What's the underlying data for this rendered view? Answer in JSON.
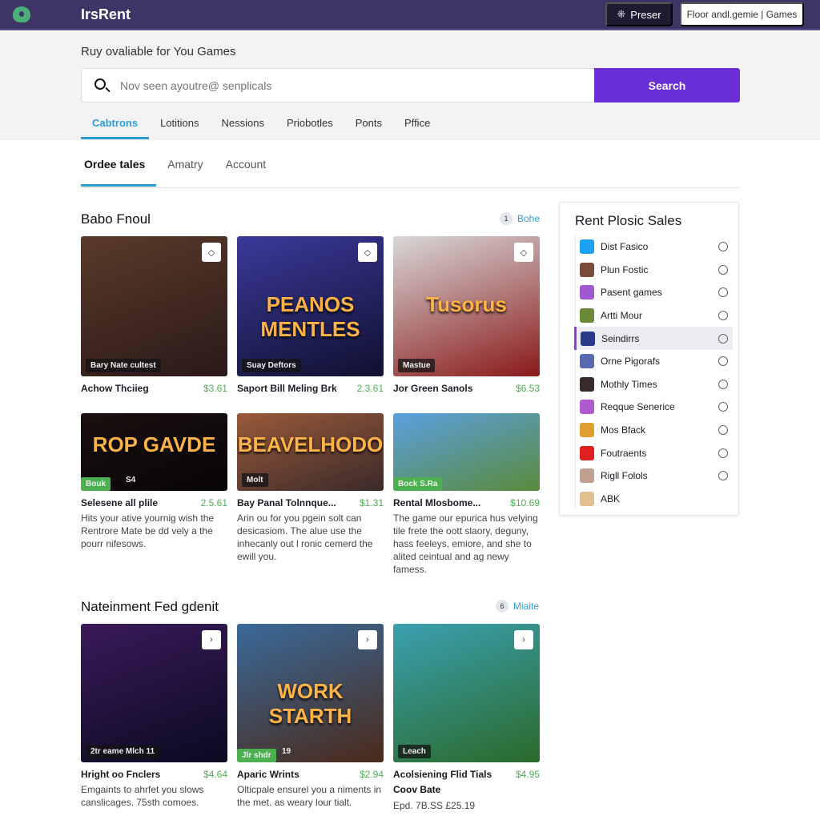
{
  "topbar": {
    "brand": "IrsRent",
    "preset_label": "Preser",
    "games_label": "Floor andl.gemie | Games"
  },
  "hero": {
    "title": "Ruy ovaliable for You Games",
    "search_placeholder": "Nov seen ayoutre@ senplicals",
    "search_button": "Search"
  },
  "tabs": [
    "Cabtrons",
    "Lotitions",
    "Nessions",
    "Priobotles",
    "Ponts",
    "Pffice"
  ],
  "subtabs": [
    "Ordee tales",
    "Amatry",
    "Account"
  ],
  "section1": {
    "title": "Babo Fnoul",
    "link_badge": "1",
    "link": "Bohe",
    "cards": [
      {
        "title": "Achow Thciieg",
        "price": "$3.61",
        "badge": "Bary Nate cultest",
        "art": "",
        "colors": [
          "#5a3a2a",
          "#2a1a18"
        ]
      },
      {
        "title": "Saport Bill Meling Brk",
        "price": "2.3.61",
        "badge": "Suay Deftors",
        "art": "PEANOS MENTLES",
        "colors": [
          "#3a3a9a",
          "#101030"
        ]
      },
      {
        "title": "Jor Green Sanols",
        "price": "$6.53",
        "badge": "Mastue",
        "art": "Tusorus",
        "colors": [
          "#d8d8d8",
          "#8a1a1a"
        ]
      },
      {
        "title": "Selesene all plile",
        "price": "2.5.61",
        "badge": "Bouk",
        "badge_extra": "S4",
        "art": "ROP GAVDE",
        "colors": [
          "#1a1010",
          "#080505"
        ],
        "desc": "Hits your ative yournig wish the Rentrore Mate be dd vely a the pourr nifesows."
      },
      {
        "title": "Bay Panal Tolnnque...",
        "price": "$1.31",
        "badge": "Molt",
        "art": "BEAVELHODO",
        "colors": [
          "#9a5a3a",
          "#3a2a2a"
        ],
        "desc": "Arin ou for you pgein solt can desicasiom. The alue use the inhecanly out l ronic cemerd the ewill you."
      },
      {
        "title": "Rental Mlosbome...",
        "price": "$10.69",
        "badge": "Bock S.Ra",
        "art": "",
        "colors": [
          "#5aa0e0",
          "#5a8a3a"
        ],
        "desc": "The game our epurica hus velying tile frete the oott slaory, deguny, hass feeleys, emiore, and she to alited ceintual and ag newy famess."
      }
    ]
  },
  "section2": {
    "title": "Nateinment Fed gdenit",
    "link_badge": "6",
    "link": "Miaite",
    "cards": [
      {
        "title": "Hright oo Fnclers",
        "price": "$4.64",
        "badge": "2tr eame Mlch 11",
        "art": "",
        "colors": [
          "#3a1a5a",
          "#0a0a20"
        ],
        "desc": "Emgaints to ahrfet you slows canslicages. 75sth comoes."
      },
      {
        "title": "Aparic Wrints",
        "price": "$2.94",
        "badge": "Jlr shdr",
        "badge_extra": "19",
        "art": "WORK STARTH",
        "colors": [
          "#3a6a9a",
          "#4a2a1a"
        ],
        "desc": "Olticpale ensurel you a niments in the met. as weary lour tialt."
      },
      {
        "title": "Acolsiening Flid Tials",
        "price": "$4.95",
        "badge": "Leach",
        "art": "",
        "colors": [
          "#3aa0b0",
          "#2a6a2a"
        ],
        "desc": "Coov Bate",
        "desc2": "Epd. 7B.SS £25.19"
      }
    ]
  },
  "sidebar": {
    "title": "Rent Plosic Sales",
    "items": [
      {
        "label": "Dist Fasico",
        "color": "#1da1f2"
      },
      {
        "label": "Plun Fostic",
        "color": "#7a4a3a"
      },
      {
        "label": "Pasent games",
        "color": "#a05ad0"
      },
      {
        "label": "Artti Mour",
        "color": "#6a8a3a"
      },
      {
        "label": "Seindirrs",
        "color": "#2a3a8a",
        "active": true
      },
      {
        "label": "Orne Pigorafs",
        "color": "#5a6ab0"
      },
      {
        "label": "Mothly Times",
        "color": "#3a2a2a"
      },
      {
        "label": "Reqque Senerice",
        "color": "#b05ad0"
      },
      {
        "label": "Mos Bfack",
        "color": "#e0a030"
      },
      {
        "label": "Foutraents",
        "color": "#e02020"
      },
      {
        "label": "Rigll Folols",
        "color": "#c0a090"
      },
      {
        "label": "ABK",
        "color": "#e0c090"
      }
    ]
  },
  "accent": {
    "purple": "#6a2fd6",
    "blue": "#2a9fd6",
    "green": "#4caf50",
    "topbar": "#3e3566"
  }
}
